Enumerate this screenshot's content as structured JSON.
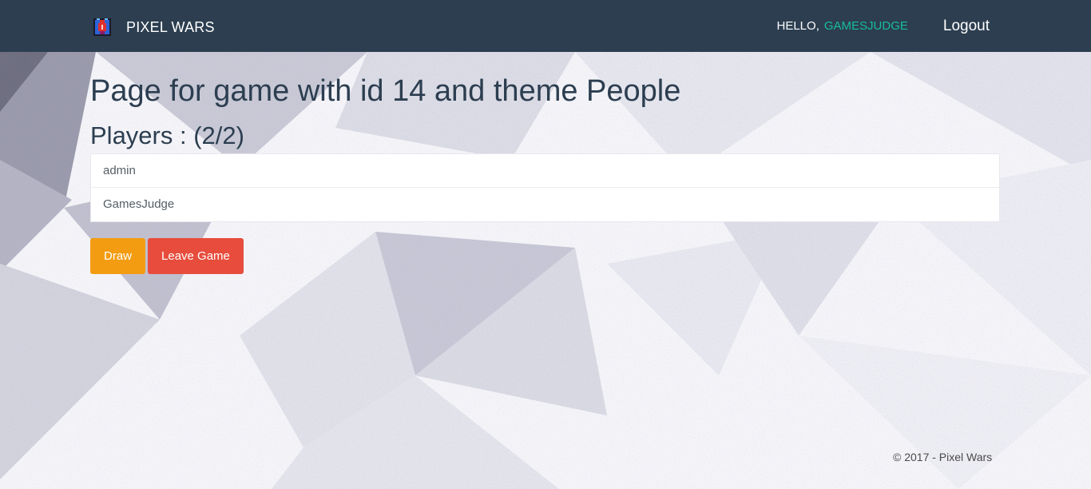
{
  "navbar": {
    "brand": "PIXEL WARS",
    "greeting": "HELLO,",
    "username": "GAMESJUDGE",
    "logout_label": "Logout"
  },
  "main": {
    "title": "Page for game with id 14 and theme People",
    "players_heading": "Players : (2/2)",
    "players": [
      "admin",
      "GamesJudge"
    ],
    "draw_label": "Draw",
    "leave_label": "Leave Game"
  },
  "footer": {
    "text": "© 2017 - Pixel Wars"
  },
  "colors": {
    "navbar": "#2c3e50",
    "accent_username": "#18bc9c",
    "draw_button": "#f39c12",
    "leave_button": "#e74c3c"
  }
}
